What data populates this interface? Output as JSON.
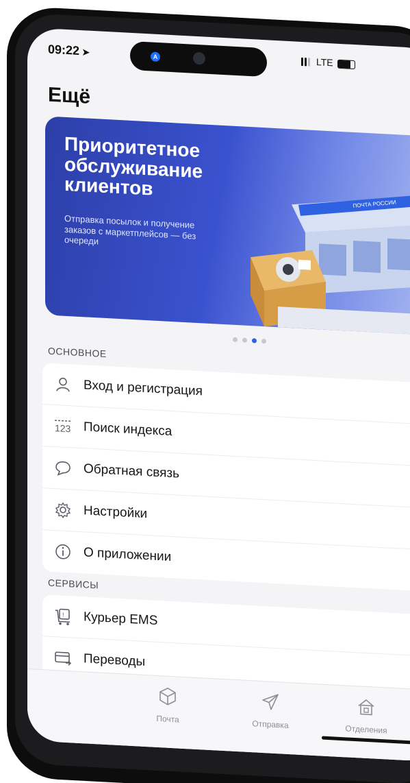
{
  "status": {
    "time": "09:22",
    "network": "LTE",
    "notch_indicator": "A"
  },
  "header": {
    "title": "Ещё"
  },
  "banner": {
    "title": "Приоритетное обслуживание клиентов",
    "subtitle": "Отправка посылок и получение заказов с маркетплейсов — без очереди",
    "sign_text": "ПОЧТА РОССИИ",
    "background_color": "#3b52cf",
    "pager": {
      "total": 4,
      "active_index": 2
    }
  },
  "main_section": {
    "label": "ОСНОВНОЕ",
    "items": [
      {
        "label": "Вход и регистрация",
        "icon": "user-icon"
      },
      {
        "label": "Поиск индекса",
        "icon": "postcode-icon",
        "icon_text": "123"
      },
      {
        "label": "Обратная связь",
        "icon": "chat-bubble-icon"
      },
      {
        "label": "Настройки",
        "icon": "gear-icon"
      },
      {
        "label": "О приложении",
        "icon": "info-icon"
      }
    ]
  },
  "services_section": {
    "label": "СЕРВИСЫ",
    "items": [
      {
        "label": "Курьер EMS",
        "icon": "courier-icon"
      },
      {
        "label": "Переводы",
        "icon": "transfer-card-icon"
      }
    ]
  },
  "tabbar": {
    "items": [
      {
        "label": "Почта",
        "icon": "parcel-box-icon"
      },
      {
        "label": "Отправка",
        "icon": "send-plane-icon"
      },
      {
        "label": "Отделения",
        "icon": "post-office-icon"
      }
    ]
  },
  "colors": {
    "accent": "#2f62e0",
    "text_primary": "#16171b",
    "text_secondary": "#8d8f97"
  }
}
